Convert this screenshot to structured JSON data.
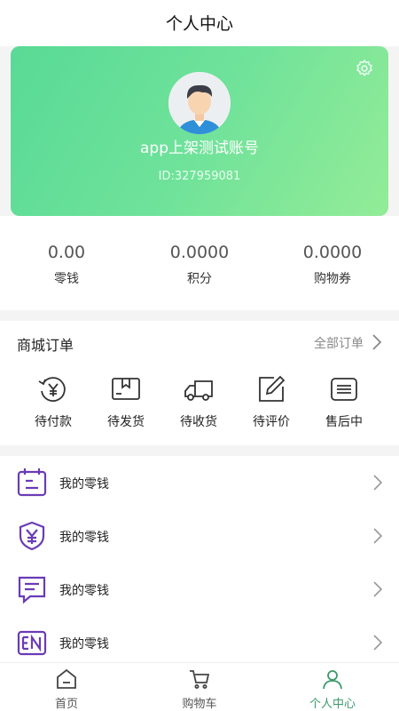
{
  "header": {
    "title": "个人中心"
  },
  "profile": {
    "username": "app上架测试账号",
    "user_id": "ID:327959081"
  },
  "stats": [
    {
      "value": "0.00",
      "label": "零钱"
    },
    {
      "value": "0.0000",
      "label": "积分"
    },
    {
      "value": "0.0000",
      "label": "购物券"
    }
  ],
  "orders": {
    "title": "商城订单",
    "all_label": "全部订单",
    "items": [
      {
        "label": "待付款",
        "icon": "pending-payment-icon"
      },
      {
        "label": "待发货",
        "icon": "pending-shipment-icon"
      },
      {
        "label": "待收货",
        "icon": "truck-icon"
      },
      {
        "label": "待评价",
        "icon": "edit-review-icon"
      },
      {
        "label": "售后中",
        "icon": "after-sales-icon"
      }
    ]
  },
  "menu": {
    "items": [
      {
        "label": "我的零钱",
        "icon": "wallet-calendar-icon"
      },
      {
        "label": "我的零钱",
        "icon": "yuan-shield-icon"
      },
      {
        "label": "我的零钱",
        "icon": "message-icon"
      },
      {
        "label": "我的零钱",
        "icon": "en-badge-icon"
      }
    ],
    "icon_color": "#6a3bb5"
  },
  "tabbar": {
    "items": [
      {
        "label": "首页",
        "icon": "home-icon"
      },
      {
        "label": "购物车",
        "icon": "cart-icon"
      },
      {
        "label": "个人中心",
        "icon": "person-icon"
      }
    ],
    "active_color": "#3d9a6a"
  },
  "colors": {
    "gradient_start": "#58da96",
    "gradient_end": "#93ec97"
  }
}
